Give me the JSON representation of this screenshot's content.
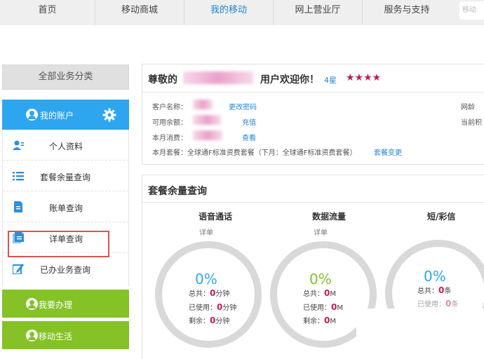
{
  "nav": {
    "items": [
      "首页",
      "移动商城",
      "我的移动",
      "网上营业厅",
      "服务与支持"
    ],
    "active_index": 2,
    "search_placeholder": "移动"
  },
  "sidebar": {
    "header": "全部业务分类",
    "account_label": "我的账户",
    "items": [
      {
        "label": "个人资料",
        "icon": "user-card-icon"
      },
      {
        "label": "套餐余量查询",
        "icon": "list-icon"
      },
      {
        "label": "账单查询",
        "icon": "document-icon"
      },
      {
        "label": "详单查询",
        "icon": "detail-document-icon"
      },
      {
        "label": "已办业务查询",
        "icon": "edit-icon"
      }
    ],
    "green_items": [
      "我要办理",
      "移动生活"
    ]
  },
  "account": {
    "greeting_prefix": "尊敬的",
    "greeting_suffix": "用户欢迎你！",
    "level": "4星",
    "stars": "★★★★",
    "customer_name_label": "客户名称：",
    "change_password": "更改密码",
    "balance_label": "可用余额：",
    "recharge": "充值",
    "monthly_spend_label": "本月消费：",
    "view": "查看",
    "plan_text": "本月套餐：全球通F标准资费套餐（下月：全球通F标准资费套餐）",
    "plan_change": "套餐变更",
    "right_label_1": "网龄",
    "right_label_2": "当前积"
  },
  "balance": {
    "title": "套餐余量查询",
    "columns": [
      {
        "title": "语音通话",
        "sub": "详单",
        "pct": "0%",
        "pct_color": "#2ea6ef",
        "total_label": "总共：",
        "total_value": "0",
        "total_unit": "分钟",
        "used_label": "已使用：",
        "used_value": "0",
        "used_unit": "分钟",
        "left_label": "剩余：",
        "left_value": "0",
        "left_unit": "分钟"
      },
      {
        "title": "数据流量",
        "sub": "详单",
        "pct": "0%",
        "pct_color": "#84c226",
        "total_label": "总共：",
        "total_value": "0",
        "total_unit": "M",
        "used_label": "已使用：",
        "used_value": "0",
        "used_unit": "M",
        "left_label": "剩余：",
        "left_value": "0",
        "left_unit": "M"
      },
      {
        "title": "短/彩信",
        "sub": "",
        "pct": "0%",
        "pct_color": "#2ea6ef",
        "total_label": "总共：",
        "total_value": "0",
        "total_unit": "条",
        "used_label": "已使用：",
        "used_value": "0",
        "used_unit": "条"
      }
    ]
  },
  "colors": {
    "blue": "#2ea6ef",
    "green": "#84c226",
    "pink": "#c21b5b",
    "link": "#1f86d6"
  }
}
